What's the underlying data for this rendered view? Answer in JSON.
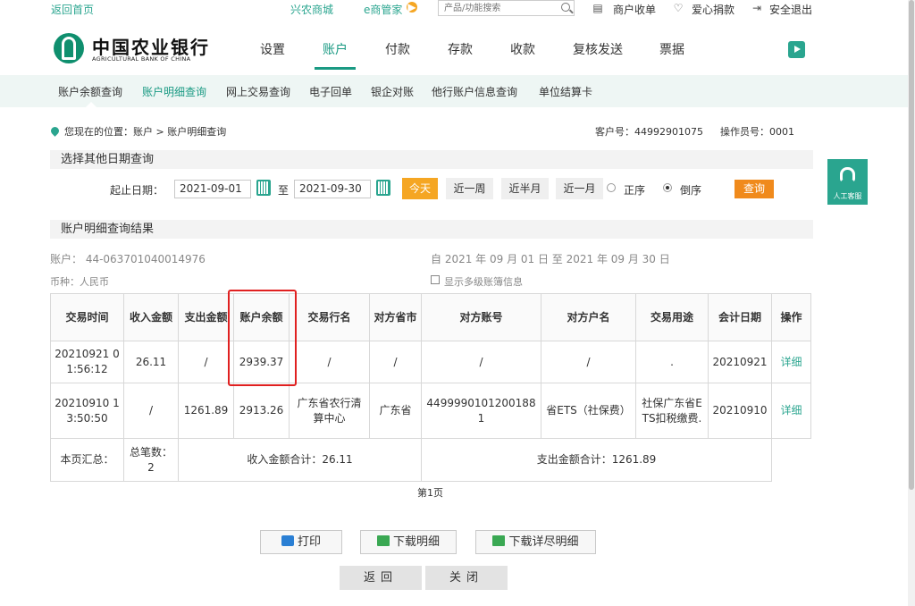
{
  "topbar": {
    "home": "返回首页",
    "mall": "兴农商城",
    "emanager": "e商管家",
    "search_placeholder": "产品/功能搜索",
    "merchant_pay": "商户收单",
    "donation": "爱心捐款",
    "logout": "安全退出"
  },
  "brand": {
    "cn": "中国农业银行",
    "en": "AGRICULTURAL BANK OF CHINA"
  },
  "mainnav": [
    "设置",
    "账户",
    "付款",
    "存款",
    "收款",
    "复核发送",
    "票据"
  ],
  "subnav": [
    "账户余额查询",
    "账户明细查询",
    "网上交易查询",
    "电子回单",
    "银企对账",
    "他行账户信息查询",
    "单位结算卡"
  ],
  "location": "您现在的位置：账户 > 账户明细查询",
  "customer_no": "客户号：44992901075",
  "operator_no": "操作员号：0001",
  "filter": {
    "title": "选择其他日期查询",
    "start_label": "起止日期：",
    "start": "2021-09-01",
    "to": "至",
    "end": "2021-09-30",
    "today": "今天",
    "week": "近一周",
    "halfmonth": "近半月",
    "month": "近一月",
    "asc": "正序",
    "desc": "倒序",
    "query": "查询"
  },
  "result": {
    "title": "账户明细查询结果",
    "account": "账户：  44-063701040014976",
    "period": "自 2021 年 09 月 01 日 至 2021 年 09 月 30 日",
    "currency": "币种：人民币",
    "show_multi": "显示多级账簿信息"
  },
  "table": {
    "headers": [
      "交易时间",
      "收入金额",
      "支出金额",
      "账户余额",
      "交易行名",
      "对方省市",
      "对方账号",
      "对方户名",
      "交易用途",
      "会计日期",
      "操作"
    ],
    "rows": [
      [
        "20210921 01:56:12",
        "26.11",
        "/",
        "2939.37",
        "/",
        "/",
        "/",
        "/",
        ".",
        "20210921",
        "详细"
      ],
      [
        "20210910 13:50:50",
        "/",
        "1261.89",
        "2913.26",
        "广东省农行清算中心",
        "广东省",
        "44999901012001881",
        "省ETS（社保费）",
        "社保广东省ETS扣税缴费.",
        "20210910",
        "详细"
      ]
    ],
    "summary": {
      "label": "本页汇总：",
      "count": "总笔数：2",
      "income": "收入金额合计：26.11",
      "expense": "支出金额合计：1261.89"
    }
  },
  "page_label": "第1页",
  "actions": {
    "print": "打印",
    "download": "下载明细",
    "download_full": "下载详尽明细",
    "back": "返回",
    "close": "关闭"
  },
  "service": "人工客服"
}
